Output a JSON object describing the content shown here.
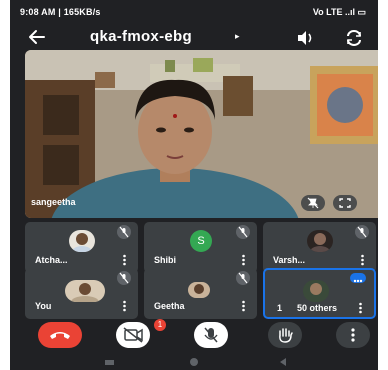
{
  "status_bar": {
    "time": "9:08 AM | 165KB/s",
    "right": "Vo LTE ..ıl ▭"
  },
  "top_bar": {
    "title": "qka-fmox-ebg",
    "caret": "▸"
  },
  "main_video": {
    "participant_name": "sangeetha"
  },
  "tiles": [
    {
      "name": "Atcha...",
      "muted": true
    },
    {
      "name": "Shibi",
      "avatar_initial": "S",
      "avatar_color": "#34a853",
      "muted": true
    },
    {
      "name": "Varsh...",
      "muted": true
    },
    {
      "name": "You",
      "muted": true
    },
    {
      "name": "Geetha",
      "muted": true
    },
    {
      "name": "50 others",
      "prefix": "1"
    }
  ],
  "controls": {
    "camera_badge": "1"
  },
  "colors": {
    "background": "#202124",
    "tile": "#3c4043",
    "end_call": "#ea4335",
    "active_border": "#1a73e8"
  }
}
